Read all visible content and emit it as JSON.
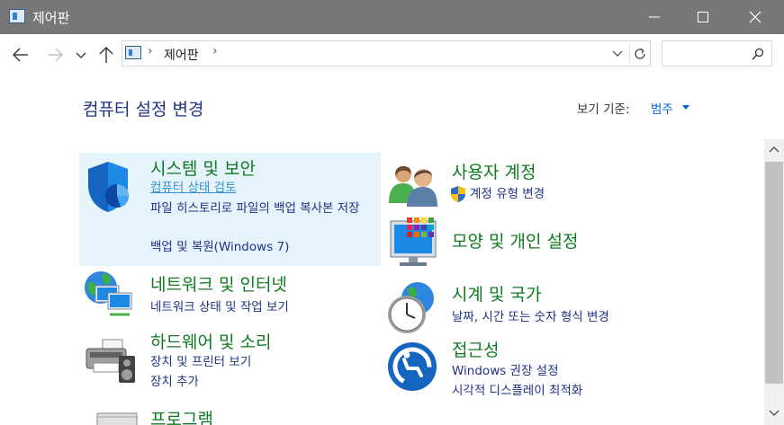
{
  "window": {
    "title": "제어판",
    "buttons": {
      "minimize": "minimize",
      "maximize": "maximize",
      "close": "close"
    }
  },
  "nav": {
    "breadcrumb": [
      "제어판"
    ],
    "search_placeholder": ""
  },
  "header": {
    "title": "컴퓨터 설정 변경",
    "view_by_label": "보기 기준:",
    "view_by_value": "범주"
  },
  "categories": [
    {
      "title": "시스템 및 보안",
      "links": [
        "컴퓨터 상태 검토",
        "파일 히스토리로 파일의 백업 복사본 저장",
        "백업 및 복원(Windows 7)"
      ]
    },
    {
      "title": "네트워크 및 인터넷",
      "links": [
        "네트워크 상태 및 작업 보기"
      ]
    },
    {
      "title": "하드웨어 및 소리",
      "links": [
        "장치 및 프린터 보기",
        "장치 추가"
      ]
    },
    {
      "title": "프로그램",
      "links": []
    },
    {
      "title": "사용자 계정",
      "links": [
        "계정 유형 변경"
      ]
    },
    {
      "title": "모양 및 개인 설정",
      "links": []
    },
    {
      "title": "시계 및 국가",
      "links": [
        "날짜, 시간 또는 숫자 형식 변경"
      ]
    },
    {
      "title": "접근성",
      "links": [
        "Windows 권장 설정",
        "시각적 디스플레이 최적화"
      ]
    }
  ],
  "colors": {
    "titlebar": "#777777",
    "category_title": "#0f7a1f",
    "link": "#1e3287",
    "highlight": "#e5f3fb"
  }
}
